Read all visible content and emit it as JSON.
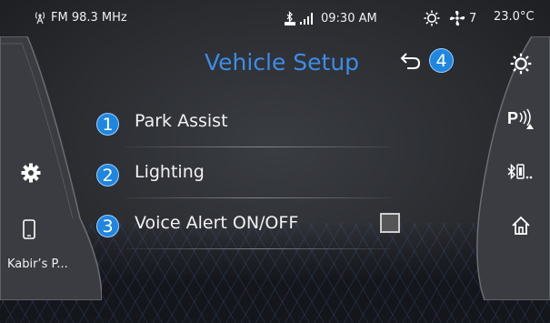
{
  "status_bar": {
    "radio": "FM 98.3 MHz",
    "time": "09:30 AM",
    "fan_speed": "7",
    "temperature": "23.0°C"
  },
  "left_panel": {
    "phone_label": "Kabir’s P..."
  },
  "header": {
    "title": "Vehicle Setup",
    "back_badge": "4"
  },
  "menu": {
    "items": [
      {
        "number": "1",
        "label": "Park Assist"
      },
      {
        "number": "2",
        "label": "Lighting"
      },
      {
        "number": "3",
        "label": "Voice Alert ON/OFF",
        "checked": false
      }
    ]
  },
  "colors": {
    "accent": "#3d8ce6",
    "badge": "#1f86e0",
    "panel": "#3a3c41"
  },
  "icons": [
    "radio-signal-icon",
    "bluetooth-icon",
    "signal-bars-icon",
    "climate-sun-icon",
    "fan-icon",
    "settings-gear-icon",
    "phone-icon",
    "back-arrow-icon",
    "park-assist-icon",
    "bluetooth-device-icon",
    "home-icon"
  ]
}
